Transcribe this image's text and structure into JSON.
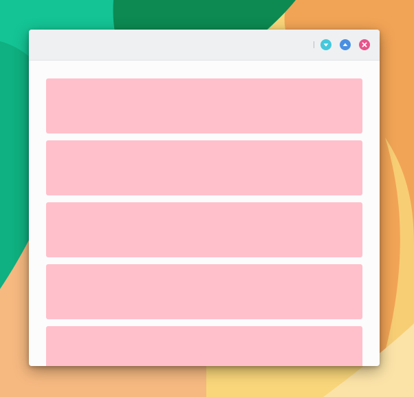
{
  "desktop": {
    "wallpaper_colors": {
      "teal": "#14c494",
      "green_dark": "#0c8a52",
      "green_mid": "#0fb081",
      "orange_light": "#f6b980",
      "orange": "#f2a456",
      "yellow": "#f9d67a",
      "cream": "#fbe3a8"
    }
  },
  "window": {
    "title": "",
    "controls": {
      "minimize_icon": "chevron-down-icon",
      "maximize_icon": "chevron-up-icon",
      "close_icon": "close-icon",
      "minimize_color": "#45c8dc",
      "maximize_color": "#4a90e2",
      "close_color": "#e8538a"
    },
    "panels": [
      {
        "color": "#ffc0cb"
      },
      {
        "color": "#ffc0cb"
      },
      {
        "color": "#ffc0cb"
      },
      {
        "color": "#ffc0cb"
      },
      {
        "color": "#ffc0cb"
      }
    ]
  }
}
